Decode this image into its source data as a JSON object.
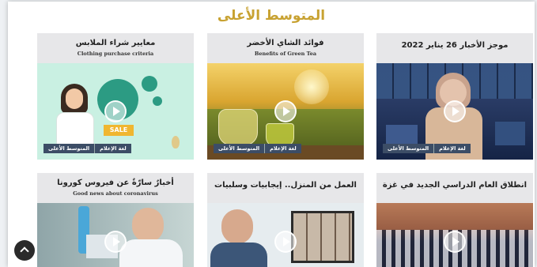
{
  "section_title": "المتوسط الأعلى",
  "cards": [
    {
      "title_ar": "موجز الأخبار 26 يناير 2022",
      "title_en": "",
      "tag1": "لغة الإعلام",
      "tag2": "المتوسط الأعلى"
    },
    {
      "title_ar": "فوائد الشاي الأخضر",
      "title_en": "Benefits of Green Tea",
      "tag1": "لغة الإعلام",
      "tag2": "المتوسط الأعلى"
    },
    {
      "title_ar": "معايير شراء الملابس",
      "title_en": "Clothing purchase criteria",
      "tag1": "لغة الإعلام",
      "tag2": "المتوسط الأعلى",
      "sale": "SALE"
    },
    {
      "title_ar": "انطلاق العام الدراسي الجديد في غزة",
      "title_en": ""
    },
    {
      "title_ar": "العمل من المنزل.. إيجابيات وسلبيات",
      "title_en": ""
    },
    {
      "title_ar": "أخبارٌ سارّةٌ عن فيروس كورونا",
      "title_en": "Good news about coronavirus"
    }
  ],
  "icons": {
    "play": "play-icon",
    "scroll_top": "chevron-up-icon"
  }
}
